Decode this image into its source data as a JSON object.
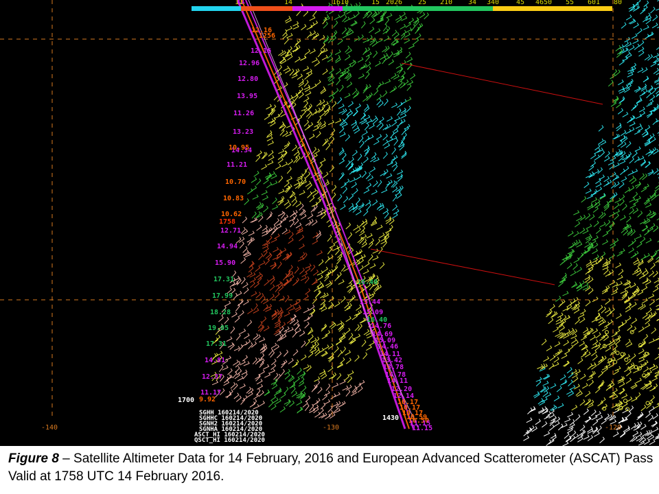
{
  "figure": {
    "colorbar": {
      "labels": [
        "11",
        "14",
        "1610",
        "15",
        "2026",
        "25",
        "210",
        "34",
        "340",
        "45",
        "4650",
        "55",
        "601",
        "80"
      ],
      "colors": [
        "#22d3ee",
        "#ef4f1a",
        "#d51cf0",
        "#22c55e",
        "#facc15"
      ]
    },
    "lon_labels": [
      "-140",
      "-130",
      "-120"
    ],
    "swath_colors": {
      "cyan": "#2ee6f0",
      "green": "#3cc83c",
      "yellow": "#e8e840",
      "salmon": "#f3b5a8",
      "orange_red": "#c0401c",
      "magenta": "#e23ce8",
      "white": "#ffffff"
    },
    "track_labels": {
      "left_track": [
        {
          "text": "12.16",
          "color": "#ff6600"
        },
        {
          "text": "12.96",
          "color": "#d51cf0"
        },
        {
          "text": "12.80",
          "color": "#d51cf0"
        },
        {
          "text": "13.95",
          "color": "#d51cf0"
        },
        {
          "text": "11.26",
          "color": "#d51cf0"
        },
        {
          "text": "13.23",
          "color": "#d51cf0"
        },
        {
          "text": "14.34",
          "color": "#d51cf0"
        },
        {
          "text": "10.95",
          "color": "#ff6600"
        },
        {
          "text": "11.21",
          "color": "#d51cf0"
        },
        {
          "text": "10.70",
          "color": "#ff6600"
        },
        {
          "text": "10.83",
          "color": "#ff6600"
        },
        {
          "text": "10.62",
          "color": "#ff6600"
        },
        {
          "text": "1758",
          "color": "#ff3300"
        },
        {
          "text": "12.71",
          "color": "#d51cf0"
        },
        {
          "text": "14.94",
          "color": "#d51cf0"
        },
        {
          "text": "15.90",
          "color": "#d51cf0"
        },
        {
          "text": "17.31",
          "color": "#22c55e"
        },
        {
          "text": "17.99",
          "color": "#22c55e"
        },
        {
          "text": "18.28",
          "color": "#22c55e"
        },
        {
          "text": "19.05",
          "color": "#22c55e"
        },
        {
          "text": "17.31",
          "color": "#22c55e"
        },
        {
          "text": "14.81",
          "color": "#d51cf0"
        },
        {
          "text": "12.37",
          "color": "#d51cf0"
        },
        {
          "text": "11.17",
          "color": "#d51cf0"
        },
        {
          "text": "9.92",
          "color": "#ff6600"
        }
      ],
      "right_track": [
        {
          "text": "16.40",
          "color": "#22c55e"
        },
        {
          "text": "15.44",
          "color": "#d51cf0"
        },
        {
          "text": "15.09",
          "color": "#d51cf0"
        },
        {
          "text": "16.40",
          "color": "#22c55e"
        },
        {
          "text": "14.76",
          "color": "#d51cf0"
        },
        {
          "text": "14.69",
          "color": "#d51cf0"
        },
        {
          "text": "15.09",
          "color": "#d51cf0"
        },
        {
          "text": "14.46",
          "color": "#d51cf0"
        },
        {
          "text": "14.11",
          "color": "#d51cf0"
        },
        {
          "text": "13.42",
          "color": "#d51cf0"
        },
        {
          "text": "13.78",
          "color": "#d51cf0"
        },
        {
          "text": "14.78",
          "color": "#d51cf0"
        },
        {
          "text": "14.11",
          "color": "#d51cf0"
        },
        {
          "text": "12.20",
          "color": "#d51cf0"
        },
        {
          "text": "12.14",
          "color": "#d51cf0"
        },
        {
          "text": "10.17",
          "color": "#ff6600"
        },
        {
          "text": "10.17",
          "color": "#ff6600"
        },
        {
          "text": "10.17",
          "color": "#ff6600"
        },
        {
          "text": "10.59",
          "color": "#ff6600"
        },
        {
          "text": "10.50",
          "color": "#ff6600"
        },
        {
          "text": "11.15",
          "color": "#d51cf0"
        },
        {
          "text": "11.15",
          "color": "#d51cf0"
        }
      ],
      "top_small": [
        {
          "text": "11",
          "color": "#d51cf0"
        },
        {
          "text": "1256",
          "color": "#ff6600"
        },
        {
          "text": "12.16",
          "color": "#d51cf0"
        }
      ]
    },
    "time_labels": {
      "left": "1700",
      "right": "1430"
    },
    "legend_lines": [
      "SGHH  160214/2020",
      "SGHHC 160214/2020",
      "SGNH2 160214/2020",
      "SGNHA 160214/2020",
      "ASCT_HI 160214/2020",
      "QSCT_HI 160214/2020"
    ]
  },
  "caption": {
    "figure_label": "Figure 8",
    "text": " – Satellite Altimeter Data for 14 February, 2016 and European Advanced Scatterometer (ASCAT) Pass Valid at 1758 UTC 14 February 2016."
  }
}
